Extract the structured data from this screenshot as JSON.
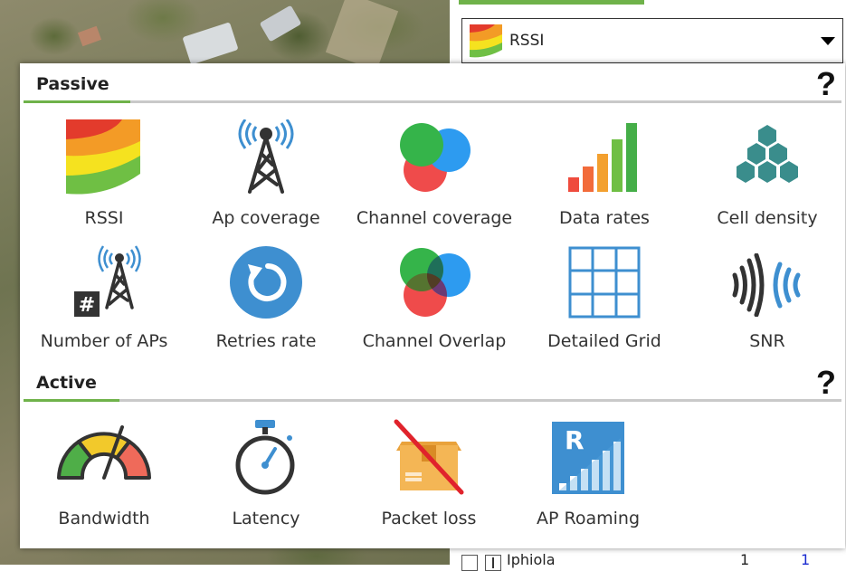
{
  "dropdown": {
    "selected": "RSSI",
    "icon": "rssi-icon"
  },
  "passive": {
    "title": "Passive",
    "help": "?",
    "items": [
      {
        "label": "RSSI",
        "icon": "rssi-icon"
      },
      {
        "label": "Ap coverage",
        "icon": "antenna-tower-icon"
      },
      {
        "label": "Channel coverage",
        "icon": "channel-coverage-icon"
      },
      {
        "label": "Data rates",
        "icon": "data-rates-icon"
      },
      {
        "label": "Cell density",
        "icon": "cell-density-icon"
      },
      {
        "label": "Number of APs",
        "icon": "number-of-aps-icon"
      },
      {
        "label": "Retries rate",
        "icon": "retry-icon"
      },
      {
        "label": "Channel Overlap",
        "icon": "channel-overlap-icon"
      },
      {
        "label": "Detailed Grid",
        "icon": "grid-icon"
      },
      {
        "label": "SNR",
        "icon": "snr-icon"
      }
    ]
  },
  "active": {
    "title": "Active",
    "help": "?",
    "items": [
      {
        "label": "Bandwidth",
        "icon": "speedometer-icon"
      },
      {
        "label": "Latency",
        "icon": "stopwatch-icon"
      },
      {
        "label": "Packet loss",
        "icon": "packet-loss-icon"
      },
      {
        "label": "AP Roaming",
        "icon": "ap-roaming-icon"
      }
    ]
  },
  "tree": {
    "label": "Iphiola",
    "value1": "1",
    "value2": "1"
  },
  "colors": {
    "accent_green": "#6fb24a",
    "icon_blue": "#3e8fd0",
    "link_blue": "#1a2bd0"
  }
}
